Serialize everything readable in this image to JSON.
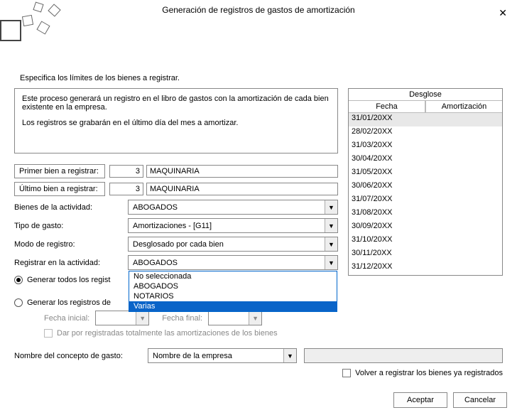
{
  "title": "Generación de registros de gastos de amortización",
  "instruction": "Especifica los límites de los bienes a registrar.",
  "description": {
    "p1": "Este proceso generará un registro en el libro de gastos con la amortización de cada bien existente en la empresa.",
    "p2": "Los registros se grabarán en el último día del mes a amortizar."
  },
  "fields": {
    "primer_label": "Primer bien a registrar:",
    "primer_num": "3",
    "primer_text": "MAQUINARIA",
    "ultimo_label": "Último bien a registrar:",
    "ultimo_num": "3",
    "ultimo_text": "MAQUINARIA",
    "bienes_label": "Bienes de la actividad:",
    "bienes_value": "ABOGADOS",
    "tipo_label": "Tipo de gasto:",
    "tipo_value": "Amortizaciones - [G11]",
    "modo_label": "Modo de registro:",
    "modo_value": "Desglosado por cada bien",
    "registrar_label": "Registrar en la actividad:",
    "registrar_value": "ABOGADOS",
    "radio_all": "Generar todos los registros de amortizacion",
    "radio_range": "Generar los registros de",
    "fecha_inicial_label": "Fecha inicial:",
    "fecha_final_label": "Fecha final:",
    "chk_text": "Dar por registradas totalmente las amortizaciones de los bienes",
    "nombre_label": "Nombre del concepto de gasto:",
    "nombre_value": "Nombre de la empresa",
    "volver_chk": "Volver a registrar los bienes ya registrados"
  },
  "dropdown_options": [
    "No seleccionada",
    "ABOGADOS",
    "NOTARIOS",
    "Varias"
  ],
  "dropdown_selected": "Varias",
  "table": {
    "header_title": "Desglose",
    "col1": "Fecha",
    "col2": "Amortización",
    "rows": [
      "31/01/20XX",
      "28/02/20XX",
      "31/03/20XX",
      "30/04/20XX",
      "31/05/20XX",
      "30/06/20XX",
      "31/07/20XX",
      "31/08/20XX",
      "30/09/20XX",
      "31/10/20XX",
      "30/11/20XX",
      "31/12/20XX"
    ]
  },
  "buttons": {
    "accept": "Aceptar",
    "cancel": "Cancelar"
  }
}
